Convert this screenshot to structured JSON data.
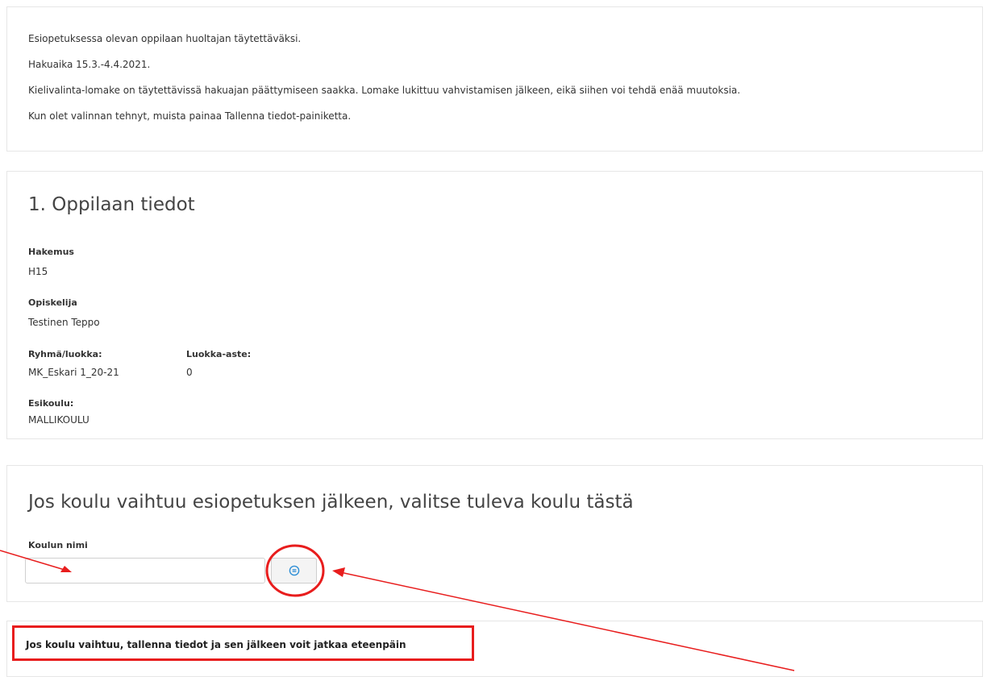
{
  "intro": {
    "lines": [
      "Esiopetuksessa olevan oppilaan huoltajan täytettäväksi.",
      "Hakuaika 15.3.-4.4.2021.",
      "Kielivalinta-lomake on täytettävissä hakuajan päättymiseen saakka. Lomake lukittuu vahvistamisen jälkeen, eikä siihen voi tehdä enää muutoksia.",
      "Kun olet valinnan tehnyt, muista painaa Tallenna tiedot-painiketta."
    ]
  },
  "student_section": {
    "title": "1. Oppilaan tiedot",
    "application_label": "Hakemus",
    "application_value": "H15",
    "student_label": "Opiskelija",
    "student_value": "Testinen Teppo",
    "group_label": "Ryhmä/luokka:",
    "group_value": "MK_Eskari 1_20-21",
    "grade_label": "Luokka-aste:",
    "grade_value": "0",
    "preschool_label": "Esikoulu:",
    "preschool_value": "MALLIKOULU"
  },
  "school_change_section": {
    "title": "Jos koulu vaihtuu esiopetuksen jälkeen, valitse tuleva koulu tästä",
    "school_name_label": "Koulun nimi",
    "school_name_value": "",
    "lookup_icon": "list-lookup-icon"
  },
  "notice": {
    "text": "Jos koulu vaihtuu, tallenna tiedot ja sen jälkeen voit jatkaa eteenpäin"
  },
  "colors": {
    "annotation_red": "#e81d1d",
    "icon_blue": "#2f8fd6",
    "border": "#e6e6e6"
  }
}
